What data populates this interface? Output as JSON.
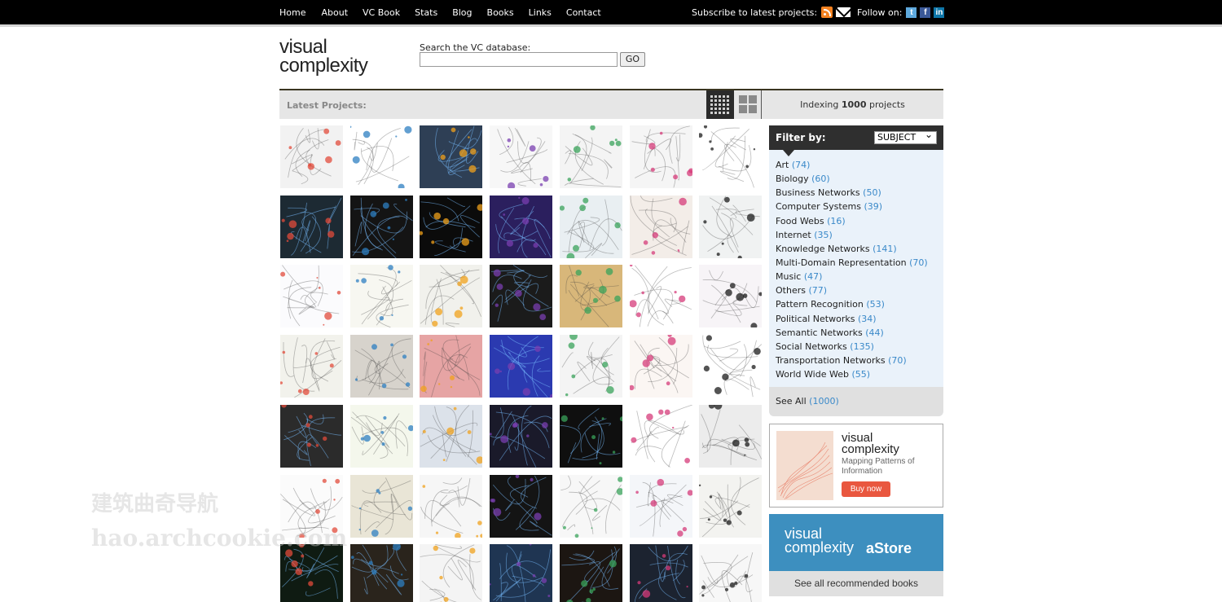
{
  "nav": {
    "items": [
      "Home",
      "About",
      "VC Book",
      "Stats",
      "Blog",
      "Books",
      "Links",
      "Contact"
    ],
    "subscribe_label": "Subscribe to latest projects:",
    "follow_label": "Follow on:"
  },
  "logo": {
    "line1": "visual",
    "line2": "complexity"
  },
  "search": {
    "label": "Search the VC database:",
    "value": "",
    "button": "GO"
  },
  "latest": {
    "label": "Latest Projects:",
    "indexing_prefix": "Indexing",
    "indexing_count": "1000",
    "indexing_suffix": "projects"
  },
  "filter": {
    "title": "Filter by:",
    "select_value": "SUBJECT",
    "items": [
      {
        "label": "Art",
        "count": "(74)"
      },
      {
        "label": "Biology",
        "count": "(60)"
      },
      {
        "label": "Business Networks",
        "count": "(50)"
      },
      {
        "label": "Computer Systems",
        "count": "(39)"
      },
      {
        "label": "Food Webs",
        "count": "(16)"
      },
      {
        "label": "Internet",
        "count": "(35)"
      },
      {
        "label": "Knowledge Networks",
        "count": "(141)"
      },
      {
        "label": "Multi-Domain Representation",
        "count": "(70)"
      },
      {
        "label": "Music",
        "count": "(47)"
      },
      {
        "label": "Others",
        "count": "(77)"
      },
      {
        "label": "Pattern Recognition",
        "count": "(53)"
      },
      {
        "label": "Political Networks",
        "count": "(34)"
      },
      {
        "label": "Semantic Networks",
        "count": "(44)"
      },
      {
        "label": "Social Networks",
        "count": "(135)"
      },
      {
        "label": "Transportation Networks",
        "count": "(70)"
      },
      {
        "label": "World Wide Web",
        "count": "(55)"
      }
    ],
    "see_all": "See All",
    "see_all_count": "(1000)"
  },
  "book": {
    "title1": "visual",
    "title2": "complexity",
    "subtitle1": "Mapping Patterns of",
    "subtitle2": "Information",
    "buy": "Buy now"
  },
  "astore": {
    "line1": "visual",
    "line2": "complexity",
    "brand": "aStore",
    "recommended": "See all recommended books"
  },
  "watermark": {
    "line1": "建筑曲奇导航",
    "line2": "hao.archcookie.com"
  },
  "thumb_colors": [
    [
      "#f2f2f2",
      "#ffffff",
      "#2e3f55",
      "#f7f7f7",
      "#f4f4f4",
      "#f5f5f5",
      "#ffffff"
    ],
    [
      "#1d2a33",
      "#141414",
      "#0b0b0b",
      "#2b1f5e",
      "#e9eff2",
      "#f3ede8",
      "#f0f2f2"
    ],
    [
      "#fbfbfd",
      "#f7f7f1",
      "#f1f1ec",
      "#1b1b1b",
      "#d8b77a",
      "#ffffff",
      "#f7f4f7"
    ],
    [
      "#f2f2ec",
      "#d7d3cc",
      "#e6a4a4",
      "#2b3ab0",
      "#f4f4f4",
      "#fbf6f3",
      "#ffffff"
    ],
    [
      "#2b2b2b",
      "#f4f7ec",
      "#dce2ea",
      "#1a1a2a",
      "#0f0f0f",
      "#ffffff",
      "#ececec"
    ],
    [
      "#fbfbfb",
      "#e9e5d6",
      "#f6f6f6",
      "#141414",
      "#f7f7f7",
      "#f4f6f9",
      "#f3f3f0"
    ],
    [
      "#0f1b12",
      "#2a241c",
      "#f4f4f4",
      "#1f3552",
      "#1c1612",
      "#1c2330",
      "#f7f7f7"
    ]
  ]
}
